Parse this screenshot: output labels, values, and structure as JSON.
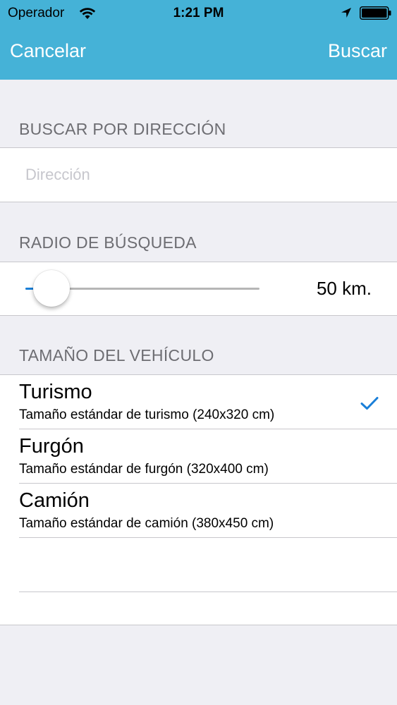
{
  "status_bar": {
    "carrier": "Operador",
    "time": "1:21 PM",
    "icons": [
      "wifi-icon",
      "location-arrow-icon",
      "battery-icon"
    ]
  },
  "nav": {
    "cancel_label": "Cancelar",
    "search_label": "Buscar"
  },
  "address_section": {
    "header": "BUSCAR POR DIRECCIÓN",
    "placeholder": "Dirección",
    "value": ""
  },
  "radius_section": {
    "header": "RADIO DE BÚSQUEDA",
    "value_label": "50 km."
  },
  "vehicle_section": {
    "header": "TAMAÑO DEL VEHÍCULO",
    "options": [
      {
        "title": "Turismo",
        "subtitle": "Tamaño estándar de turismo (240x320 cm)",
        "selected": true
      },
      {
        "title": "Furgón",
        "subtitle": "Tamaño estándar de furgón (320x400 cm)",
        "selected": false
      },
      {
        "title": "Camión",
        "subtitle": "Tamaño estándar de camión (380x450 cm)",
        "selected": false
      }
    ]
  },
  "colors": {
    "nav_bar": "#45b2d7",
    "background": "#efeff4",
    "accent": "#1a7fd8",
    "section_header_text": "#6d6d72",
    "separator": "#c8c7cc"
  }
}
